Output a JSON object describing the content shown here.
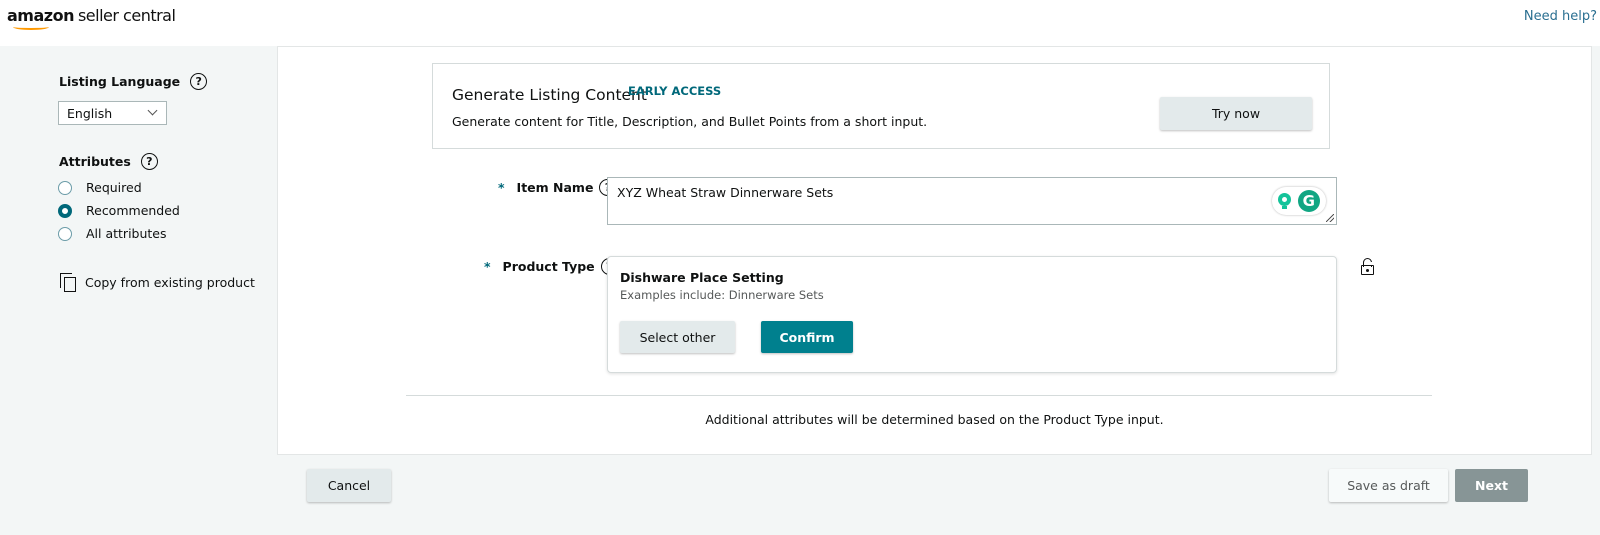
{
  "header": {
    "logo_brand": "amazon",
    "logo_product": "seller central",
    "need_help": "Need help?"
  },
  "sidebar": {
    "listing_language_label": "Listing Language",
    "language_selected": "English",
    "attributes_label": "Attributes",
    "attribute_options": [
      {
        "label": "Required",
        "checked": false
      },
      {
        "label": "Recommended",
        "checked": true
      },
      {
        "label": "All attributes",
        "checked": false
      }
    ],
    "copy_from_existing": "Copy from existing product",
    "help_glyph": "?"
  },
  "generate": {
    "title": "Generate Listing Content",
    "badge": "EARLY ACCESS",
    "description": "Generate content for Title, Description, and Bullet Points from a short input.",
    "try_now": "Try now"
  },
  "form": {
    "required_marker": "*",
    "item_name_label": "Item Name",
    "item_name_value": "XYZ Wheat Straw Dinnerware Sets",
    "grammarly_glyph": "G",
    "product_type_label": "Product Type",
    "product_type": {
      "name": "Dishware Place Setting",
      "examples": "Examples include: Dinnerware Sets",
      "select_other": "Select other",
      "confirm": "Confirm"
    },
    "additional_note": "Additional attributes will be determined based on the Product Type input."
  },
  "footer": {
    "cancel": "Cancel",
    "save_as_draft": "Save as draft",
    "next": "Next"
  },
  "colors": {
    "accent_teal": "#00808e",
    "link_blue": "#2a6f91",
    "disabled_next": "#879596",
    "logo_smile": "#ff9900"
  }
}
